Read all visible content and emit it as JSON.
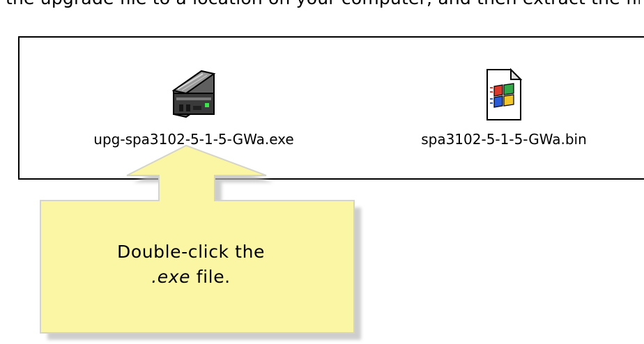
{
  "header_text": "the upgrade file to a location on your computer, and then extract the files from the .zip archive to the same directory.",
  "files": [
    {
      "name": "upg-spa3102-5-1-5-GWa.exe",
      "icon": "hard-drive-installer-icon"
    },
    {
      "name": "spa3102-5-1-5-GWa.bin",
      "icon": "windows-document-icon"
    }
  ],
  "callout": {
    "line1": "Double-click the",
    "ext": ".exe",
    "line2_suffix": " file.",
    "color": "#fbf6a3",
    "border_color": "#d4d4c8"
  }
}
